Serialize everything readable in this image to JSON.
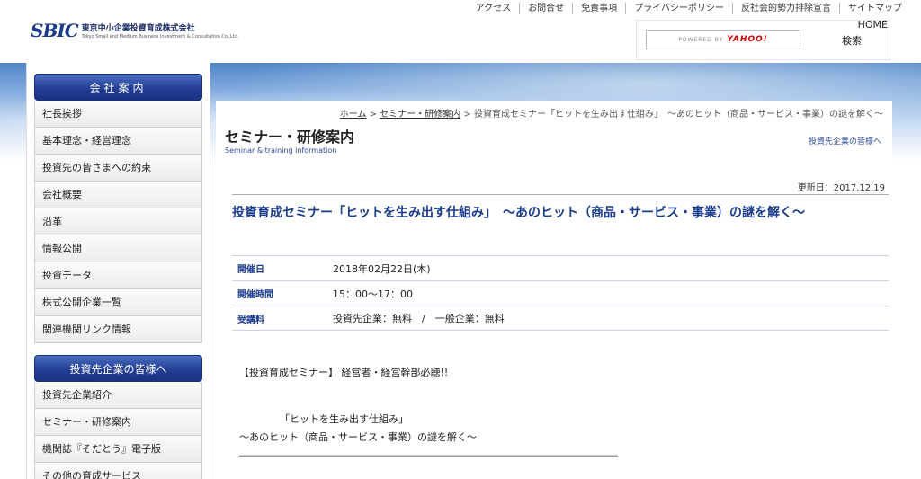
{
  "header": {
    "logo_mark": "SBIC",
    "logo_name": "東京中小企業投資育成株式会社",
    "logo_en": "Tokyo Small and Medium Business Investment & Consultation Co.,Ltd.",
    "topnav": [
      "アクセス",
      "お問合せ",
      "免責事項",
      "プライバシーポリシー",
      "反社会的勢力排除宣言",
      "サイトマップ"
    ],
    "home": "HOME",
    "search_powered": "POWERED BY",
    "search_brand": "YAHOO!",
    "search_button": "検索"
  },
  "sidebar": {
    "section1_title": "会社案内",
    "section1_items": [
      "社長挨拶",
      "基本理念・経営理念",
      "投資先の皆さまへの約束",
      "会社概要",
      "沿革",
      "情報公開",
      "投資データ",
      "株式公開企業一覧",
      "関連機関リンク情報"
    ],
    "section2_title": "投資先企業の皆様へ",
    "section2_items": [
      "投資先企業紹介",
      "セミナー・研修案内",
      "機関誌『そだとう』電子版",
      "その他の育成サービス"
    ]
  },
  "breadcrumb": {
    "home": "ホーム",
    "sep": " > ",
    "parent": "セミナー・研修案内",
    "current": "投資育成セミナー「ヒットを生み出す仕組み」　～あのヒット（商品・サービス・事業）の謎を解く～"
  },
  "page": {
    "title": "セミナー・研修案内",
    "subtitle": "Seminar & training information",
    "side_link": "投資先企業の皆様へ",
    "updated": "更新日：2017.12.19",
    "article_title": "投資育成セミナー「ヒットを生み出す仕組み」　～あのヒット（商品・サービス・事業）の謎を解く～"
  },
  "info": [
    {
      "label": "開催日",
      "value": "2018年02月22日(木)"
    },
    {
      "label": "開催時間",
      "value": "15：00～17：00"
    },
    {
      "label": "受講料",
      "value": "投資先企業：無料　/　一般企業：無料"
    }
  ],
  "body": {
    "line1": "【投資育成セミナー】 経営者・経営幹部必聴!!",
    "line2": "「ヒットを生み出す仕組み」",
    "line3": "～あのヒット（商品・サービス・事業）の謎を解く～",
    "line4": "――――――――――――――――――――――――――――――――――――――――――"
  },
  "colors": {
    "nav_blue": "#233e93",
    "title_blue": "#1a3a8a"
  }
}
